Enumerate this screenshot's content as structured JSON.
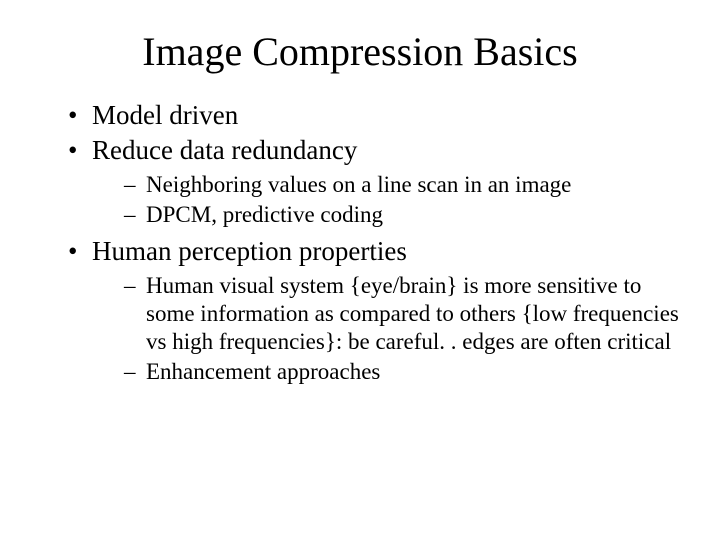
{
  "title": "Image Compression Basics",
  "bullets": {
    "b1": "Model driven",
    "b2": "Reduce data redundancy",
    "b2_sub1": "Neighboring values on a line scan in an image",
    "b2_sub2": "DPCM, predictive coding",
    "b3": "Human perception properties",
    "b3_sub1": "Human visual system {eye/brain} is more sensitive to some information as compared to others {low frequencies vs high frequencies}: be careful. . edges are often critical",
    "b3_sub2": "Enhancement approaches"
  }
}
